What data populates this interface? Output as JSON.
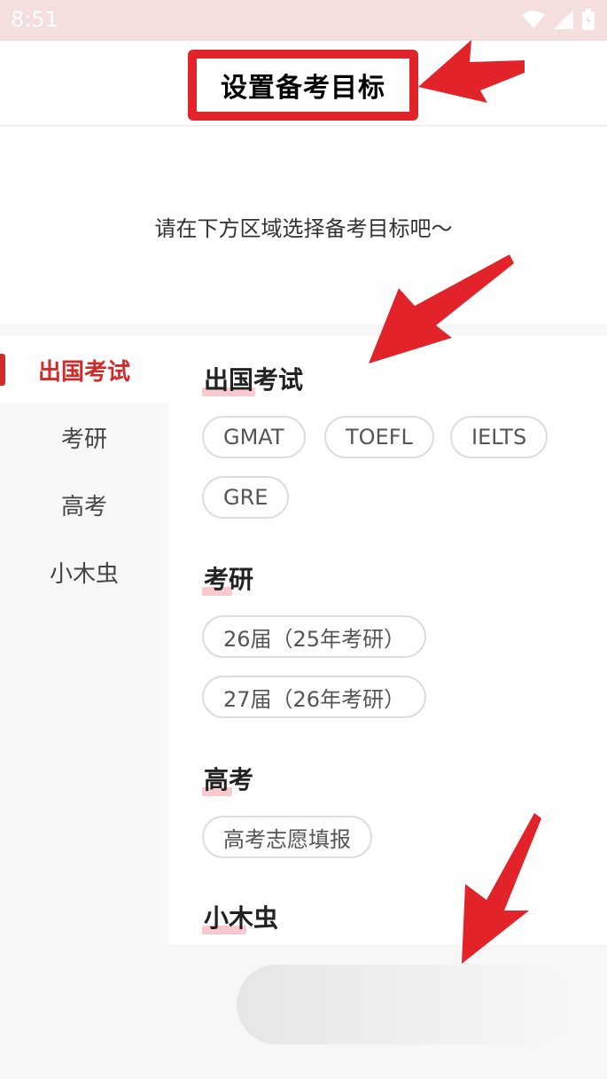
{
  "status_bar": {
    "time": "8:51",
    "icons": [
      "wifi-icon",
      "signal-icon",
      "battery-icon"
    ]
  },
  "header": {
    "title": "设置备考目标"
  },
  "hint": {
    "text": "请在下方区域选择备考目标吧～"
  },
  "sidebar": {
    "items": [
      {
        "label": "出国考试",
        "active": true
      },
      {
        "label": "考研",
        "active": false
      },
      {
        "label": "高考",
        "active": false
      },
      {
        "label": "小木虫",
        "active": false
      }
    ]
  },
  "sections": [
    {
      "title": "出国考试",
      "options": [
        "GMAT",
        "TOEFL",
        "IELTS",
        "GRE"
      ]
    },
    {
      "title": "考研",
      "options": [
        "26届（25年考研）",
        "27届（26年考研）"
      ]
    },
    {
      "title": "高考",
      "options": [
        "高考志愿填报"
      ]
    },
    {
      "title": "小木虫",
      "options": []
    }
  ],
  "colors": {
    "accent": "#d12a2a",
    "annotation_red": "#e2232a",
    "status_bar_bg": "#f4dede"
  }
}
